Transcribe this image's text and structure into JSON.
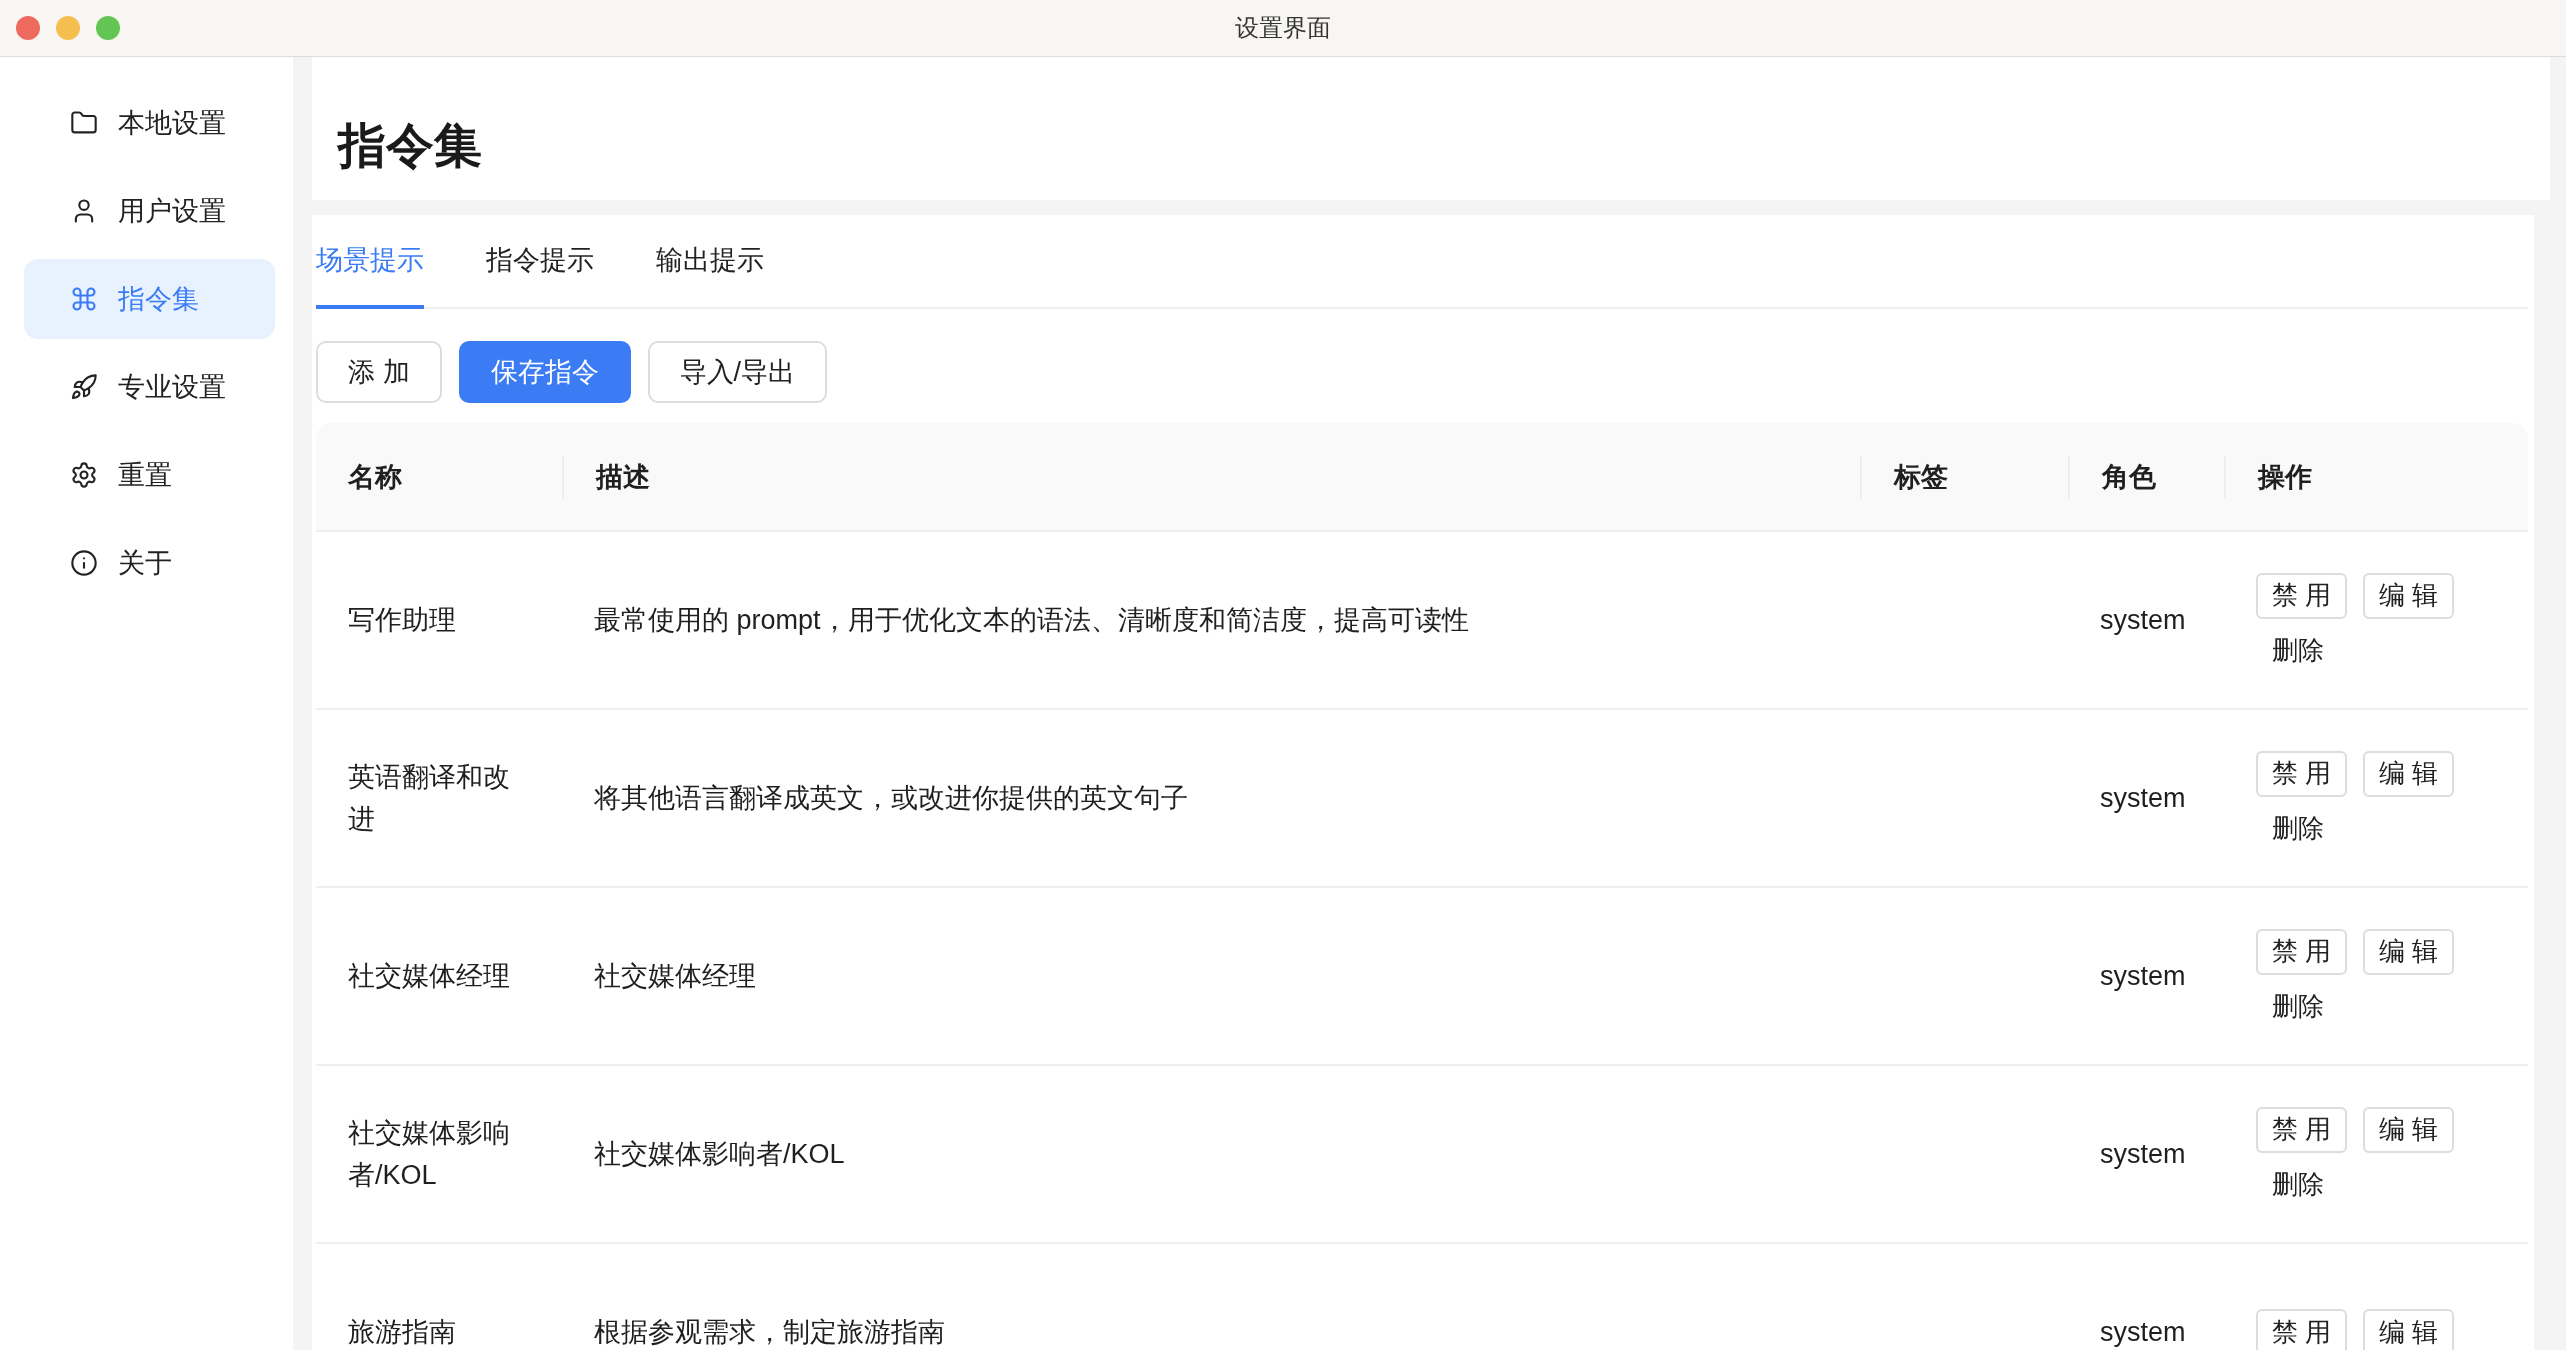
{
  "window": {
    "title": "设置界面"
  },
  "sidebar": {
    "items": [
      {
        "label": "本地设置",
        "selected": false
      },
      {
        "label": "用户设置",
        "selected": false
      },
      {
        "label": "指令集",
        "selected": true
      },
      {
        "label": "专业设置",
        "selected": false
      },
      {
        "label": "重置",
        "selected": false
      },
      {
        "label": "关于",
        "selected": false
      }
    ]
  },
  "page": {
    "title": "指令集"
  },
  "tabs": [
    {
      "label": "场景提示",
      "selected": true
    },
    {
      "label": "指令提示",
      "selected": false
    },
    {
      "label": "输出提示",
      "selected": false
    }
  ],
  "toolbar": [
    {
      "label": "添 加",
      "kind": "default"
    },
    {
      "label": "保存指令",
      "kind": "primary"
    },
    {
      "label": "导入/导出",
      "kind": "default"
    }
  ],
  "table": {
    "columns": [
      "名称",
      "描述",
      "标签",
      "角色",
      "操作"
    ],
    "rows": [
      {
        "name": "写作助理",
        "description": "最常使用的 prompt，用于优化文本的语法、清晰度和简洁度，提高可读性",
        "role": "system",
        "actions": [
          "禁 用",
          "编 辑"
        ],
        "delete": "删除"
      },
      {
        "name": "英语翻译和改进",
        "description": "将其他语言翻译成英文，或改进你提供的英文句子",
        "role": "system",
        "actions": [
          "禁 用",
          "编 辑"
        ],
        "delete": "删除"
      },
      {
        "name": "社交媒体经理",
        "description": "社交媒体经理",
        "role": "system",
        "actions": [
          "禁 用",
          "编 辑"
        ],
        "delete": "删除"
      },
      {
        "name": "社交媒体影响者/KOL",
        "description": "社交媒体影响者/KOL",
        "role": "system",
        "actions": [
          "禁 用",
          "编 辑"
        ],
        "delete": "删除"
      },
      {
        "name": "旅游指南",
        "description": "根据参观需求，制定旅游指南",
        "role": "system",
        "actions": [
          "禁 用",
          "编 辑"
        ]
      }
    ]
  }
}
